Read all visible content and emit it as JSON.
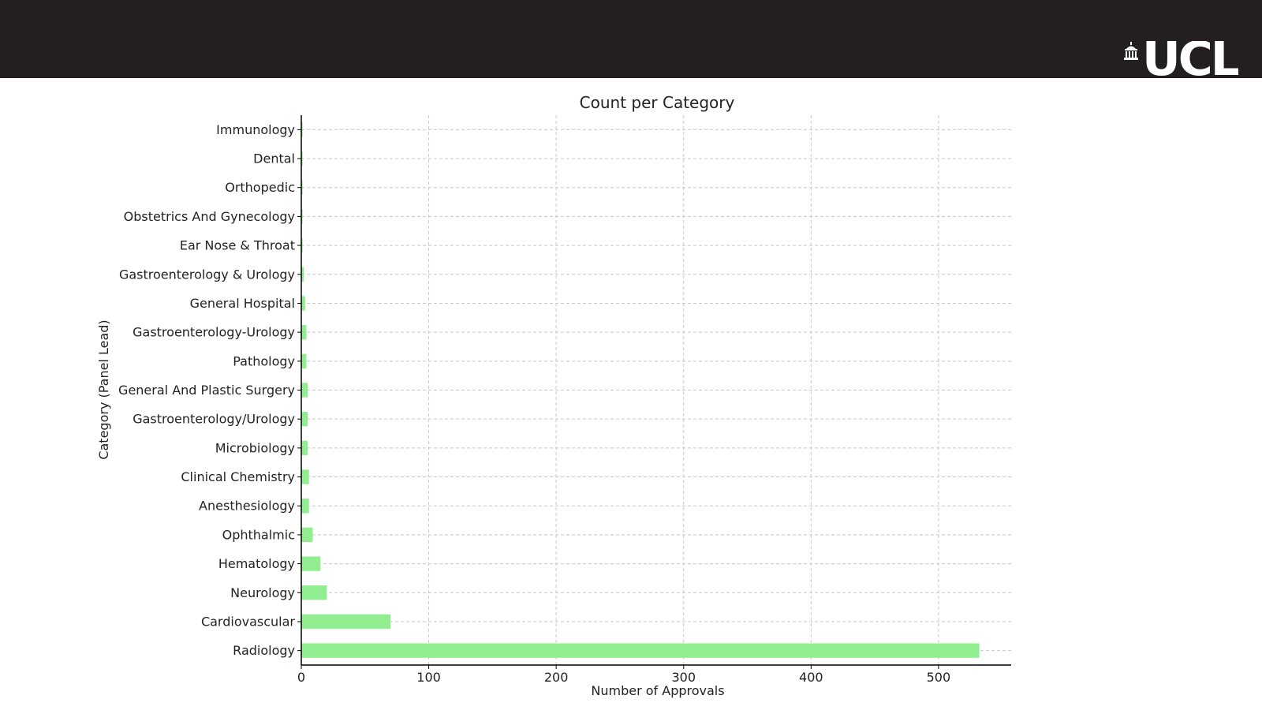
{
  "header": {
    "logo_text": "UCL",
    "background_color": "#231f20"
  },
  "chart_data": {
    "type": "bar",
    "orientation": "horizontal",
    "title": "Count per Category",
    "xlabel": "Number of Approvals",
    "ylabel": "Category (Panel Lead)",
    "categories": [
      "Radiology",
      "Cardiovascular",
      "Neurology",
      "Hematology",
      "Ophthalmic",
      "Anesthesiology",
      "Clinical Chemistry",
      "Microbiology",
      "Gastroenterology/Urology",
      "General And Plastic Surgery",
      "Pathology",
      "Gastroenterology-Urology",
      "General Hospital",
      "Gastroenterology & Urology",
      "Ear Nose & Throat",
      "Obstetrics And Gynecology",
      "Orthopedic",
      "Dental",
      "Immunology"
    ],
    "values": [
      532,
      70,
      20,
      15,
      9,
      6,
      6,
      5,
      5,
      5,
      4,
      4,
      3,
      2,
      1,
      1,
      1,
      1,
      1
    ],
    "xlim": [
      0,
      557
    ],
    "xticks": [
      0,
      100,
      200,
      300,
      400,
      500
    ],
    "bar_color": "#90ee90",
    "grid": true
  }
}
